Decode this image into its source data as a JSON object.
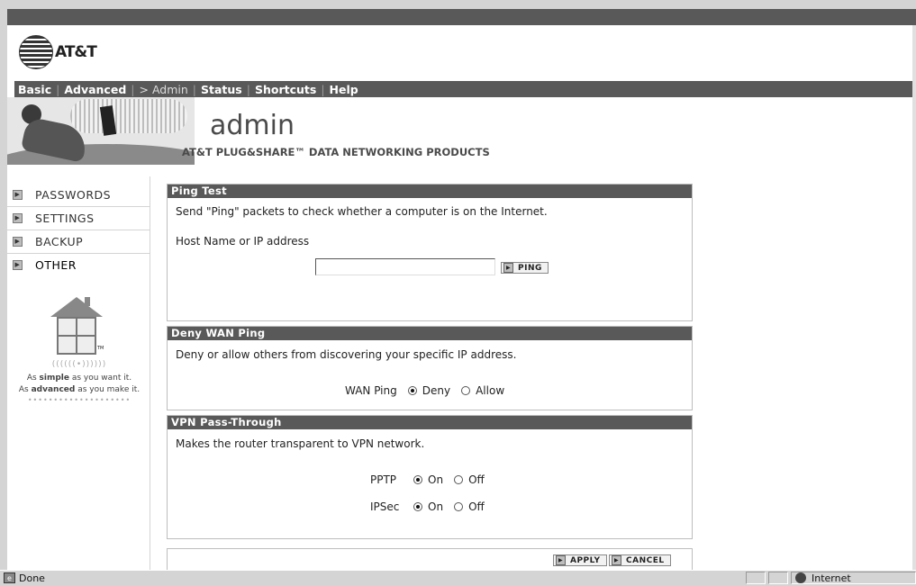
{
  "brand": {
    "name": "AT&T"
  },
  "nav": {
    "items": [
      {
        "label": "Basic"
      },
      {
        "label": "Advanced"
      },
      {
        "label": "> Admin"
      },
      {
        "label": "Status"
      },
      {
        "label": "Shortcuts"
      },
      {
        "label": "Help"
      }
    ]
  },
  "header": {
    "title": "admin",
    "subtitle": "AT&T PLUG&SHARE™ DATA NETWORKING PRODUCTS"
  },
  "sidebar": {
    "items": [
      {
        "label": "PASSWORDS"
      },
      {
        "label": "SETTINGS"
      },
      {
        "label": "BACKUP"
      },
      {
        "label": "OTHER"
      }
    ],
    "tagline_radio": "((((((•))))))",
    "tagline1_pre": "As ",
    "tagline1_bold": "simple",
    "tagline1_post": " as you want it.",
    "tagline2_pre": "As ",
    "tagline2_bold": "advanced",
    "tagline2_post": " as you make it.",
    "tm": "TM",
    "dots": "••••••••••••••••••••"
  },
  "ping": {
    "heading": "Ping Test",
    "description": "Send \"Ping\" packets to check whether a computer is on the Internet.",
    "host_label": "Host Name or IP address",
    "host_value": "",
    "button": "PING"
  },
  "deny_wan": {
    "heading": "Deny WAN Ping",
    "description": "Deny or allow others from discovering your specific IP address.",
    "row_label": "WAN Ping",
    "options": [
      "Deny",
      "Allow"
    ],
    "selected": "Deny"
  },
  "vpn": {
    "heading": "VPN Pass-Through",
    "description": "Makes the router transparent to VPN network.",
    "pptp_label": "PPTP",
    "ipsec_label": "IPSec",
    "on": "On",
    "off": "Off",
    "pptp_selected": "On",
    "ipsec_selected": "On"
  },
  "actions": {
    "apply": "APPLY",
    "cancel": "CANCEL"
  },
  "statusbar": {
    "status": "Done",
    "zone": "Internet"
  }
}
